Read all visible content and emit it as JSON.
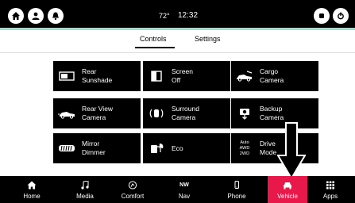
{
  "status_bar": {
    "temperature": "72°",
    "time": "12:32"
  },
  "tabs": [
    {
      "label": "Controls",
      "active": true
    },
    {
      "label": "Settings",
      "active": false
    }
  ],
  "tiles": [
    {
      "label": "Rear\nSunshade",
      "icon": "sunshade-icon"
    },
    {
      "label": "Screen\nOff",
      "icon": "screen-off-icon"
    },
    {
      "label": "Cargo\nCamera",
      "icon": "cargo-camera-icon"
    },
    {
      "label": "Rear View\nCamera",
      "icon": "rear-view-camera-icon"
    },
    {
      "label": "Surround\nCamera",
      "icon": "surround-camera-icon"
    },
    {
      "label": "Backup\nCamera",
      "icon": "backup-camera-icon"
    },
    {
      "label": "Mirror\nDimmer",
      "icon": "mirror-dimmer-icon"
    },
    {
      "label": "Eco",
      "icon": "eco-icon"
    },
    {
      "label": "Drive\nMode",
      "icon": "drive-mode-icon"
    }
  ],
  "drive_mode_icon_text": "Auto\nAWD\n2WD",
  "bottom_nav": [
    {
      "label": "Home",
      "icon": "home-icon"
    },
    {
      "label": "Media",
      "icon": "music-note-icon"
    },
    {
      "label": "Comfort",
      "icon": "comfort-icon"
    },
    {
      "label": "Nav",
      "icon": "compass-icon",
      "icon_text": "NW"
    },
    {
      "label": "Phone",
      "icon": "phone-icon"
    },
    {
      "label": "Vehicle",
      "icon": "car-icon",
      "active": true
    },
    {
      "label": "Apps",
      "icon": "apps-grid-icon"
    }
  ],
  "colors": {
    "accent_active": "#e8194a",
    "bar_accent": "#9ddfcf",
    "tile_bg": "#000000"
  }
}
